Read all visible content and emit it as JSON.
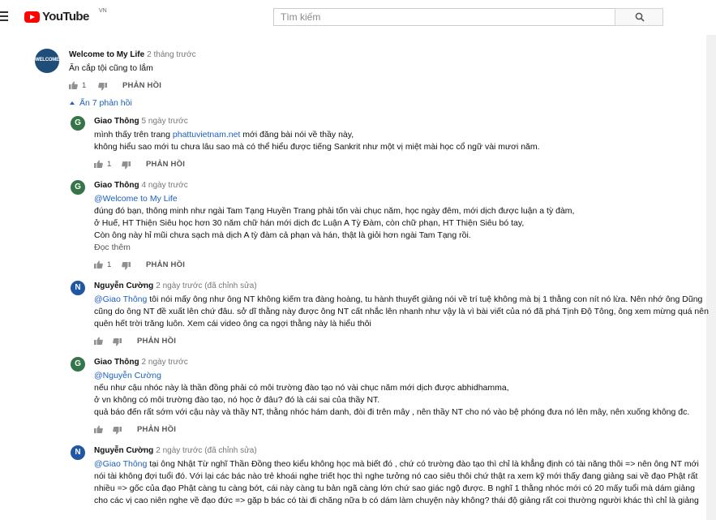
{
  "header": {
    "logo_text": "YouTube",
    "region": "VN",
    "search_placeholder": "Tìm kiếm"
  },
  "colors": {
    "accent_blue": "#1a5fbf",
    "avatar_green": "#34764a",
    "avatar_blue": "#1f56a6",
    "logo_red": "#ff0000"
  },
  "main_comment": {
    "avatar_text": "WELCOME",
    "author": "Welcome to My Life",
    "time": "2 tháng trước",
    "text": "Ăn cắp tội cũng to lắm",
    "likes": "1",
    "reply_label": "PHẢN HỒI",
    "hide_replies": "Ẩn 7 phản hồi"
  },
  "replies": [
    {
      "avatar_letter": "G",
      "author": "Giao Thông",
      "time": "5 ngày trước",
      "line1_pre": "mình thấy trên trang ",
      "line1_link": "phattuvietnam.net",
      "line1_post": " mới đăng bài nói về thầy này,",
      "line2": "không hiểu sao mới tu chưa lâu sao mà có thể hiểu được tiếng Sankrit như một vị miệt mài học cổ ngữ vài mươi năm.",
      "likes": "1",
      "reply_label": "PHẢN HỒI"
    },
    {
      "avatar_letter": "G",
      "author": "Giao Thông",
      "time": "4 ngày trước",
      "mention": "@Welcome to My Life",
      "line1": "đúng đó bạn,  thông minh như ngài Tam Tạng Huyền Trang phải tốn vài chục năm, học ngày đêm, mới dịch được luận a tỳ đàm,",
      "line2": "ở Huế, HT Thiện Siêu học hơn 30 năm chữ hán mới dịch đc Luận A Tỳ Đàm,  còn chữ phạn, HT Thiện Siêu bó tay,",
      "line3": "Còn ông này hỉ mũi chưa sạch mà dịch A tỳ đàm cả phạn và hán, thật là giỏi hơn ngài Tam Tạng rồi.",
      "read_more": "Đọc thêm",
      "likes": "1",
      "reply_label": "PHẢN HỒI"
    },
    {
      "avatar_letter": "N",
      "author": "Nguyễn Cường",
      "time": "2 ngày trước (đã chỉnh sửa)",
      "mention": "@Giao Thông",
      "line1_post": " tôi nói mấy ông như ông NT không kiếm tra đàng hoàng, tu hành thuyết giảng nói về trí tuệ không mà bị 1 thằng con nít nó lừa. Nên nhớ ông Dũng",
      "line2": "cũng do ông NT đề xuất lên chứ đâu. sở dĩ thằng này được ông NT cất nhắc lên nhanh như vậy là vì bài viết của nó đã phá Tịnh Độ Tông, ông xem mừng quá nên",
      "line3": "quên hết trời trăng luôn. Xem cái video ông ca ngợi thằng này là hiểu thôi",
      "reply_label": "PHẢN HỒI"
    },
    {
      "avatar_letter": "G",
      "author": "Giao Thông",
      "time": "2 ngày trước",
      "mention": "@Nguyễn Cường",
      "line1": "nếu như cậu nhóc này là thần đồng phải có môi trường đào tạo nó  vài chục năm mới dịch được abhidhamma,",
      "line2": "ở vn không có môi trường đào tạo, nó học ở đâu? đó là cái sai của  thầy NT.",
      "line3": "quả báo đến rất sớm với cậu này và thầy NT, thằng nhóc hám danh, đòi đi trên mây , nên thầy NT cho nó vào bệ phóng đưa nó lên mây, nên xuống không đc.",
      "reply_label": "PHẢN HỒI"
    },
    {
      "avatar_letter": "N",
      "author": "Nguyễn Cường",
      "time": "2 ngày trước (đã chỉnh sửa)",
      "mention": "@Giao Thông",
      "line1_post": " tại ông Nhật Từ nghĩ Thần Đồng theo kiểu không học mà biết đó , chứ có trường đào tạo thì chỉ là khẳng định có tài năng thôi => nên ông NT mới",
      "line2": "nói tài không đợi tuổi đó. Với lại các bác nào trẻ khoái nghe triết học thì nghe tưởng nó cao siêu thôi chứ thật ra xem kỹ mới thấy đang giảng sai về đạo Phật rất",
      "line3": "nhiều => gốc của đạo Phật càng tu càng bớt, cái này càng tu bản ngã càng lớn chứ sao giác ngộ được. B nghĩ 1 thằng nhóc mới có 20 mấy tuổi mà dám giảng",
      "line4": "cho các vị cao niên nghe về đạo đức => gặp b bác có tài đi chăng nữa b có dám làm chuyện này không? thái độ giảng rất coi thường người khác thì chỉ là giảng"
    }
  ]
}
